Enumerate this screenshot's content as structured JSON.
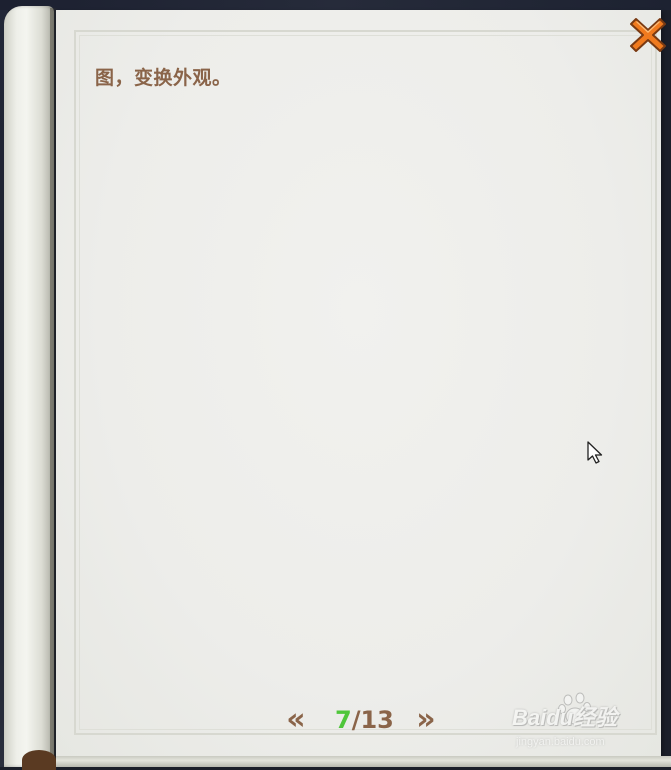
{
  "book": {
    "page_text": "图，变换外观。"
  },
  "pager": {
    "prev_label": "«",
    "next_label": "»",
    "current": "7",
    "separator": "/",
    "total": "13"
  },
  "icons": {
    "close": "close-icon",
    "cursor": "mouse-cursor-icon"
  },
  "watermark": {
    "brand": "Baidu经验",
    "url": "jingyan.baidu.com"
  },
  "colors": {
    "text_brown": "#8a6449",
    "current_page_green": "#4fc63a",
    "close_orange": "#f07a1e",
    "page_bg": "#efefec"
  }
}
